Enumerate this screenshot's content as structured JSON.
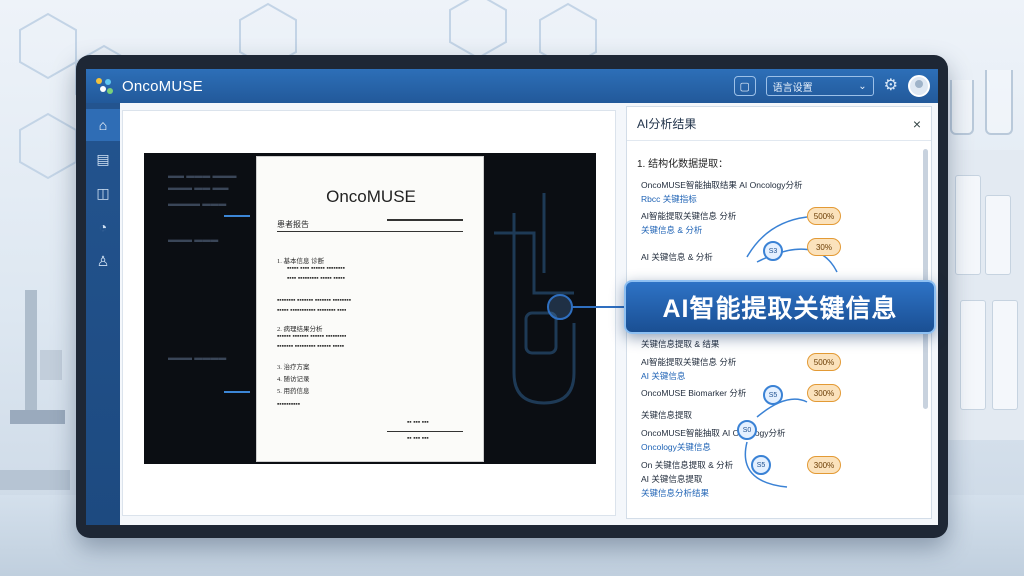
{
  "app": {
    "title": "OncoMUSE"
  },
  "topbar": {
    "select_label": "语言设置",
    "select_arrow": "⌄",
    "gear_glyph": "⚙",
    "screen_glyph": "▢"
  },
  "sidebar": {
    "icons": [
      "⌂",
      "▤",
      "◫",
      "◔",
      "♙"
    ]
  },
  "document": {
    "title": "OncoMUSE",
    "header_left": "患者报告",
    "header_right": "",
    "list": [
      "1. 基本信息 诊断",
      "2. 病理结果分析",
      "3. 治疗方案",
      "4. 随访记录",
      "5. 用药信息"
    ]
  },
  "panel": {
    "title": "AI分析结果",
    "close_glyph": "×",
    "subtitle": "1. 结构化数据提取：",
    "rows_top": [
      "OncoMUSE智能抽取结果  AI Oncology分析",
      "Rbcc 关键指标",
      "AI智能提取关键信息  分析",
      "关键信息 & 分析",
      "AI 关键信息 & 分析"
    ],
    "rows_bottom": [
      "关键信息提取 & 结果",
      "AI智能提取关键信息  分析",
      "AI 关键信息",
      "OncoMUSE Biomarker  分析",
      "关键信息提取",
      "OncoMUSE智能抽取  AI Oncology分析",
      "Oncology关键信息",
      "On 关键信息提取 & 分析",
      "AI 关键信息提取",
      "关键信息分析结果"
    ],
    "pill_values": [
      "500%",
      "30%",
      "500%",
      "300%",
      "300%"
    ],
    "node_labels": [
      "S3",
      "S5",
      "S0",
      "S5"
    ]
  },
  "callout": {
    "text": "AI智能提取关键信息"
  },
  "colors": {
    "topbar": "#2d6fb8",
    "sidebar": "#23548f",
    "callout": "#1f5aa5",
    "pill": "#fbe2bc",
    "accent": "#3a82d5"
  }
}
